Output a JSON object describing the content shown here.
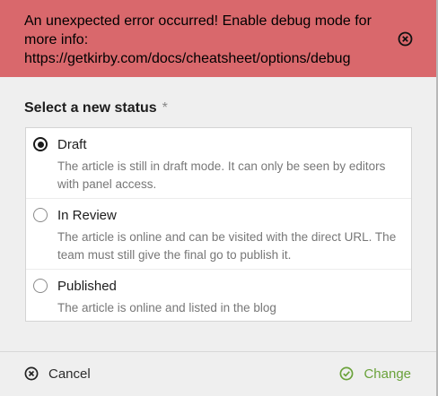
{
  "error": {
    "message": "An unexpected error occurred! Enable debug mode for more info: https://getkirby.com/docs/cheatsheet/options/debug",
    "close_icon": "close-circle-icon"
  },
  "form": {
    "label": "Select a new status",
    "required_mark": "*",
    "options": [
      {
        "title": "Draft",
        "description": "The article is still in draft mode. It can only be seen by editors with panel access.",
        "checked": true
      },
      {
        "title": "In Review",
        "description": "The article is online and can be visited with the direct URL. The team must still give the final go to publish it.",
        "checked": false
      },
      {
        "title": "Published",
        "description": "The article is online and listed in the blog",
        "checked": false
      }
    ]
  },
  "footer": {
    "cancel_label": "Cancel",
    "change_label": "Change",
    "cancel_icon": "cancel-circle-icon",
    "change_icon": "check-circle-icon"
  },
  "colors": {
    "error_bg": "#d9686c",
    "accent_green": "#6aa23a"
  }
}
